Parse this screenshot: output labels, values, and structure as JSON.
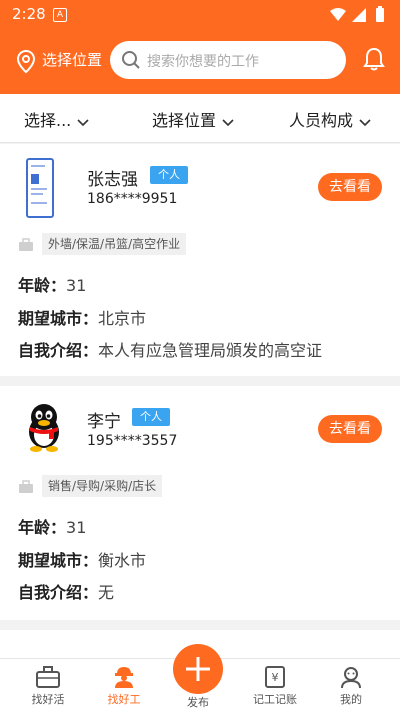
{
  "status_bar": {
    "time": "2:28",
    "notif_letter": "A"
  },
  "header": {
    "location_label": "选择位置",
    "search_placeholder": "搜索你想要的工作"
  },
  "filters": [
    {
      "label": "选择..."
    },
    {
      "label": "选择位置"
    },
    {
      "label": "人员构成"
    }
  ],
  "workers": [
    {
      "name": "张志强",
      "tag": "个人",
      "phone": "186****9951",
      "action": "去看看",
      "skills": "外墙/保温/吊篮/高空作业",
      "age_label": "年龄：",
      "age": "31",
      "city_label": "期望城市：",
      "city": "北京市",
      "intro_label": "自我介绍：",
      "intro": "本人有应急管理局頒发的高空证"
    },
    {
      "name": "李宁",
      "tag": "个人",
      "phone": "195****3557",
      "action": "去看看",
      "skills": "销售/导购/采购/店长",
      "age_label": "年龄：",
      "age": "31",
      "city_label": "期望城市：",
      "city": "衡水市",
      "intro_label": "自我介绍：",
      "intro": "无"
    }
  ],
  "bottom_nav": {
    "items": [
      {
        "label": "找好活"
      },
      {
        "label": "找好工"
      },
      {
        "label": "发布"
      },
      {
        "label": "记工记账"
      },
      {
        "label": "我的"
      }
    ]
  },
  "colors": {
    "accent": "#ff6a21",
    "tag": "#3aa4f0"
  }
}
